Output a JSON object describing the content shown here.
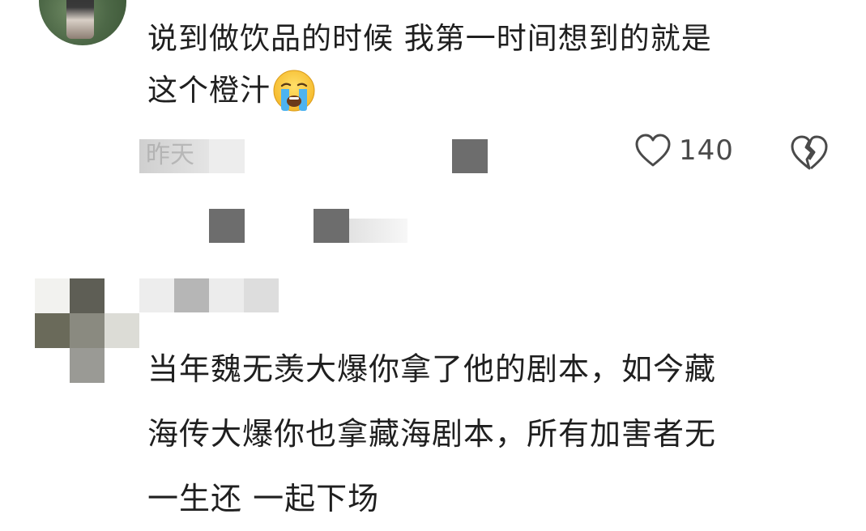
{
  "comment1": {
    "line1": "说到做饮品的时候 我第一时间想到的就是",
    "line2": "这个橙汁",
    "emoji": "loudly-crying-face-emoji",
    "meta_time_partial": "昨天",
    "like_count": "140"
  },
  "comment2": {
    "line1": "当年魏无羡大爆你拿了他的剧本，如今藏",
    "line2": "海传大爆你也拿藏海剧本，所有加害者无",
    "line3": "一生还 一起下场"
  },
  "colors": {
    "text": "#1f1f1f",
    "meta": "#4a4a4a",
    "mosaic_dark": "#6d6d6d",
    "background": "#ffffff"
  },
  "icons": {
    "like": "heart-outline-icon",
    "dislike": "broken-heart-icon"
  }
}
